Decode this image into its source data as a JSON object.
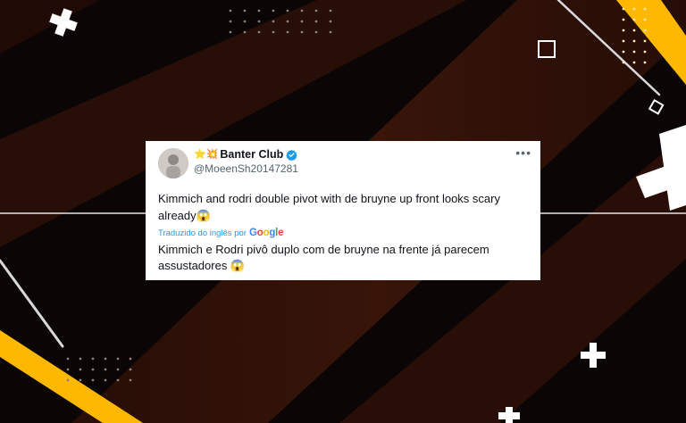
{
  "colors": {
    "background": "#0b0605",
    "stripe_dark": "#3a1408",
    "accent_yellow": "#ffb800",
    "card_bg": "#ffffff",
    "link_blue": "#1d9bf0",
    "verified_blue": "#1d9bf0"
  },
  "tweet": {
    "display_name": "Banter Club",
    "name_emoji": "⭐💥",
    "handle": "@MoeenSh20147281",
    "more_icon": "more-horizontal-icon",
    "verified_icon": "verified-badge-icon",
    "text": "Kimmich and rodri double pivot with de bruyne up front looks scary already😱",
    "translated_label": "Traduzido do inglês por",
    "google": {
      "g1": "G",
      "o1": "o",
      "o2": "o",
      "g2": "g",
      "l": "l",
      "e": "e"
    },
    "translated_text": "Kimmich e Rodri pivô duplo com de bruyne na frente já parecem assustadores 😱"
  }
}
